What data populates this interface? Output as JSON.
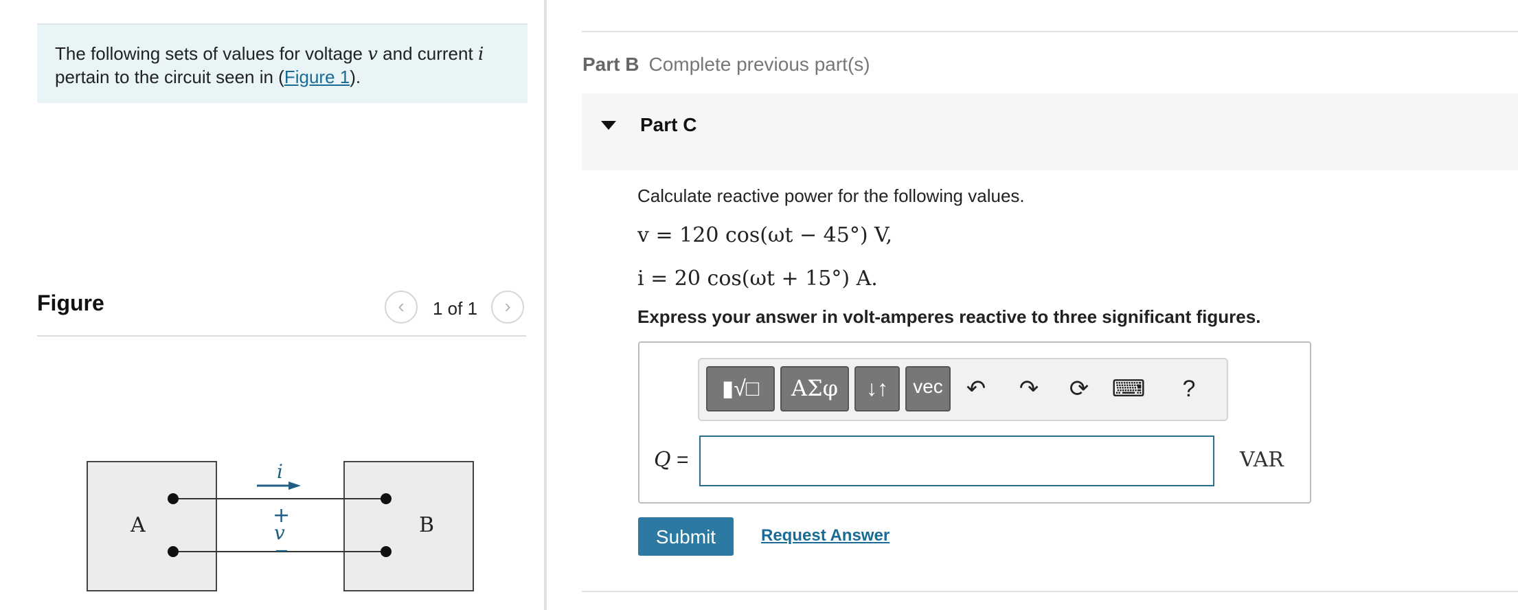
{
  "intro": {
    "text_part1": "The following sets of values for voltage ",
    "var_v": "v",
    "text_part2": " and current ",
    "var_i": "i",
    "text_part3": " pertain to the circuit seen in (",
    "figure_link": "Figure 1",
    "text_part4": ")."
  },
  "figure": {
    "title": "Figure",
    "prev_icon": "‹",
    "next_icon": "›",
    "count": "1 of 1",
    "circuit": {
      "box_a": "A",
      "box_b": "B",
      "current_label": "i",
      "plus": "+",
      "voltage_label": "v",
      "minus": "−"
    }
  },
  "partb": {
    "label": "Part B",
    "status": "Complete previous part(s)"
  },
  "partc": {
    "label": "Part C",
    "question": "Calculate reactive power for the following values.",
    "eq1": "v = 120  cos(ωt − 45°) V,",
    "eq2": "i = 20  cos(ωt + 15°) A.",
    "instruction": "Express your answer in volt-amperes reactive to three significant figures."
  },
  "toolbar": {
    "templates": "▮√□",
    "greek": "ΑΣφ",
    "arrows": "↓↑",
    "vec": "vec",
    "undo": "↶",
    "redo": "↷",
    "reset": "⟳",
    "keyboard": "⌨",
    "help": "?"
  },
  "answer": {
    "var_label": "Q",
    "equals": "=",
    "value": "",
    "unit": "VAR"
  },
  "actions": {
    "submit": "Submit",
    "request": "Request Answer"
  }
}
